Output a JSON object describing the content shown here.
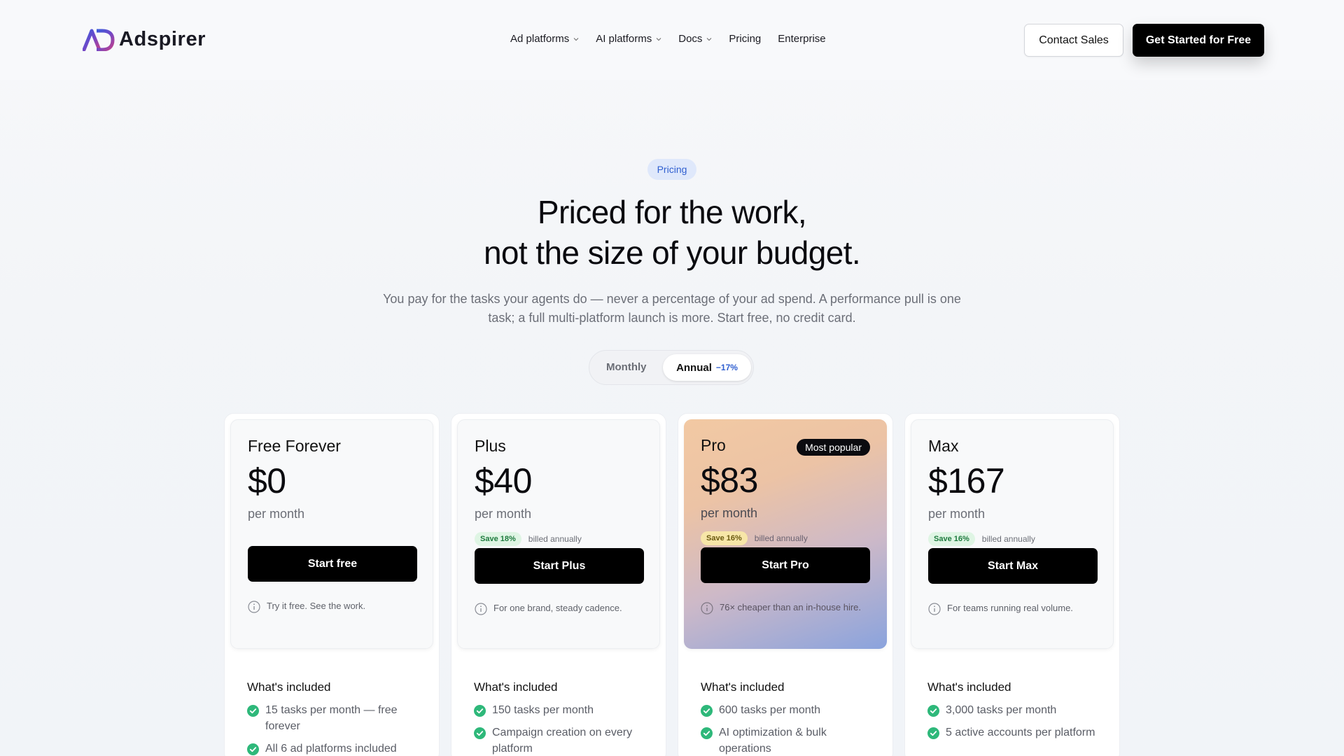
{
  "header": {
    "logo_text": "Adspirer",
    "nav": [
      {
        "label": "Ad platforms",
        "dropdown": true
      },
      {
        "label": "AI platforms",
        "dropdown": true
      },
      {
        "label": "Docs",
        "dropdown": true
      },
      {
        "label": "Pricing",
        "dropdown": false
      },
      {
        "label": "Enterprise",
        "dropdown": false
      }
    ],
    "contact_label": "Contact Sales",
    "cta_label": "Get Started for Free"
  },
  "hero": {
    "badge": "Pricing",
    "title_line1": "Priced for the work,",
    "title_line2": "not the size of your budget.",
    "subtitle": "You pay for the tasks your agents do — never a percentage of your ad spend. A performance pull is one task; a full multi-platform launch is more. Start free, no credit card."
  },
  "billing_toggle": {
    "monthly_label": "Monthly",
    "annual_label": "Annual",
    "annual_discount": "−17%",
    "selected": "Annual"
  },
  "plans": [
    {
      "name": "Free Forever",
      "price": "$0",
      "period": "per month",
      "save": "",
      "billed": "",
      "button": "Start free",
      "note": "Try it free. See the work.",
      "included_title": "What's included",
      "features": [
        "15 tasks per month — free forever",
        "All 6 ad platforms included"
      ]
    },
    {
      "name": "Plus",
      "price": "$40",
      "period": "per month",
      "save": "Save 18%",
      "billed": "billed annually",
      "button": "Start Plus",
      "note": "For one brand, steady cadence.",
      "included_title": "What's included",
      "features": [
        "150 tasks per month",
        "Campaign creation on every platform"
      ]
    },
    {
      "name": "Pro",
      "badge": "Most popular",
      "price": "$83",
      "period": "per month",
      "save": "Save 16%",
      "billed": "billed annually",
      "button": "Start Pro",
      "note": "76× cheaper than an in-house hire.",
      "included_title": "What's included",
      "features": [
        "600 tasks per month",
        "AI optimization & bulk operations"
      ]
    },
    {
      "name": "Max",
      "price": "$167",
      "period": "per month",
      "save": "Save 16%",
      "billed": "billed annually",
      "button": "Start Max",
      "note": "For teams running real volume.",
      "included_title": "What's included",
      "features": [
        "3,000 tasks per month",
        "5 active accounts per platform"
      ]
    }
  ],
  "colors": {
    "accent_blue": "#2f5fd0",
    "check_green": "#2eb87a",
    "primary_button": "#000000"
  }
}
